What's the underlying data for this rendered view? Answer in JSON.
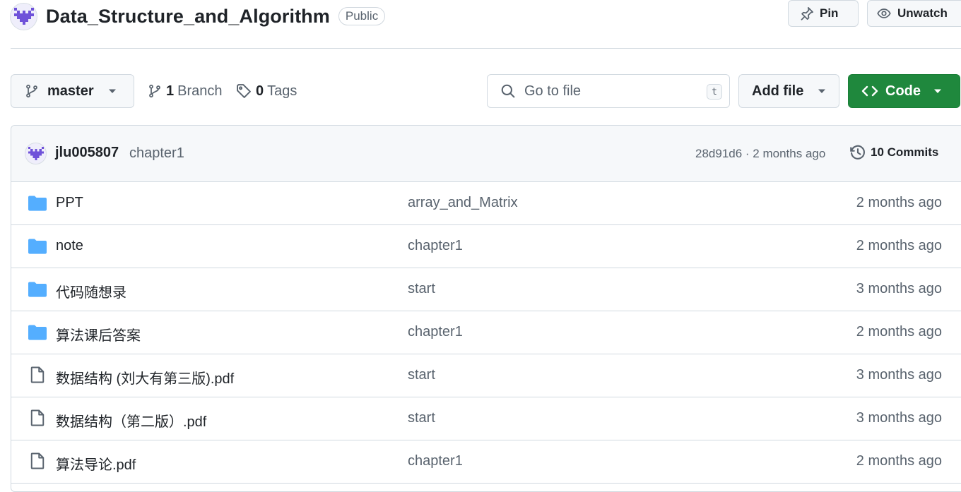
{
  "repo": {
    "name": "Data_Structure_and_Algorithm",
    "visibility": "Public",
    "pin_label": "Pin",
    "watch_label": "Unwatch"
  },
  "toolbar": {
    "branch": "master",
    "branch_count": "1",
    "branch_label": "Branch",
    "tag_count": "0",
    "tag_label": "Tags",
    "search_placeholder": "Go to file",
    "search_shortcut": "t",
    "add_file_label": "Add file",
    "code_label": "Code"
  },
  "latest_commit": {
    "author": "jlu005807",
    "message": "chapter1",
    "hash_and_time": "28d91d6 · 2 months ago",
    "commits_label": "10 Commits"
  },
  "files": [
    {
      "type": "folder",
      "name": "PPT",
      "message": "array_and_Matrix",
      "age": "2 months ago"
    },
    {
      "type": "folder",
      "name": "note",
      "message": "chapter1",
      "age": "2 months ago"
    },
    {
      "type": "folder",
      "name": "代码随想录",
      "message": "start",
      "age": "3 months ago"
    },
    {
      "type": "folder",
      "name": "算法课后答案",
      "message": "chapter1",
      "age": "2 months ago"
    },
    {
      "type": "file",
      "name": "数据结构 (刘大有第三版).pdf",
      "message": "start",
      "age": "3 months ago"
    },
    {
      "type": "file",
      "name": "数据结构（第二版）.pdf",
      "message": "start",
      "age": "3 months ago"
    },
    {
      "type": "file",
      "name": "算法导论.pdf",
      "message": "chapter1",
      "age": "2 months ago"
    }
  ],
  "colors": {
    "accent_green": "#1f883d",
    "folder_blue": "#54aeff",
    "avatar_purple": "#6f52d9"
  }
}
